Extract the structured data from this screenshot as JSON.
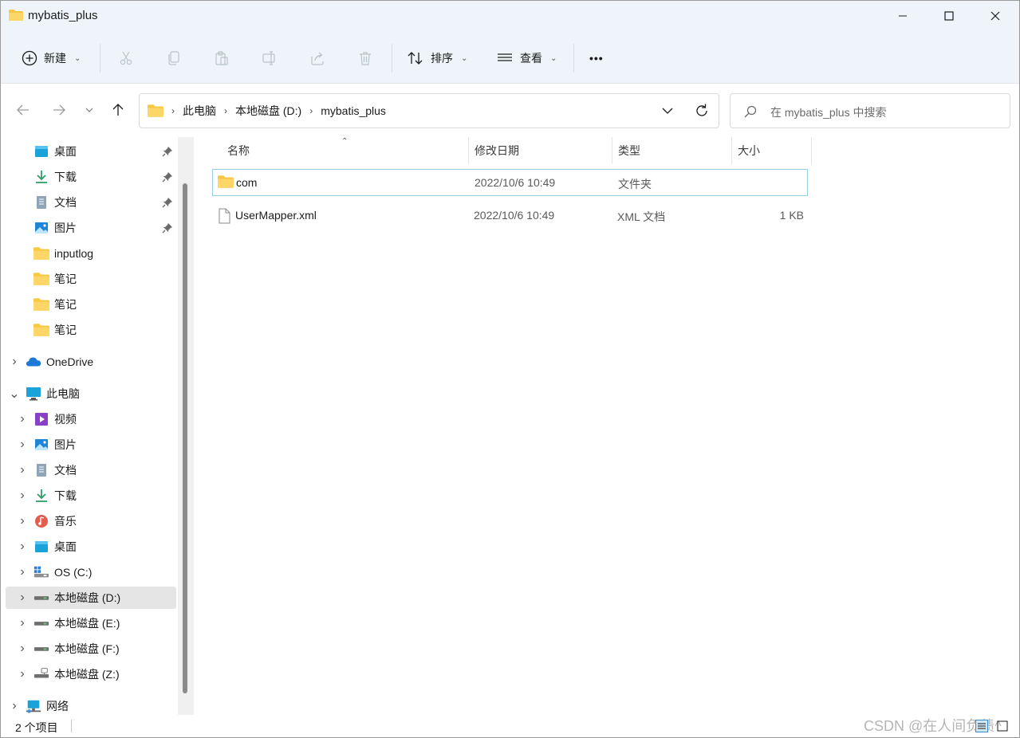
{
  "window": {
    "title": "mybatis_plus"
  },
  "toolbar": {
    "new_label": "新建",
    "sort_label": "排序",
    "view_label": "查看",
    "more_label": "•••"
  },
  "address": {
    "crumbs": [
      "此电脑",
      "本地磁盘 (D:)",
      "mybatis_plus"
    ]
  },
  "search": {
    "placeholder": "在 mybatis_plus 中搜索"
  },
  "sidebar": {
    "quick_access": [
      {
        "label": "桌面",
        "icon": "desktop-icon",
        "pinned": true
      },
      {
        "label": "下载",
        "icon": "download-icon",
        "pinned": true
      },
      {
        "label": "文档",
        "icon": "document-icon",
        "pinned": true
      },
      {
        "label": "图片",
        "icon": "picture-icon",
        "pinned": true
      },
      {
        "label": "inputlog",
        "icon": "folder-icon",
        "pinned": false
      },
      {
        "label": "笔记",
        "icon": "folder-icon",
        "pinned": false
      },
      {
        "label": "笔记",
        "icon": "folder-icon",
        "pinned": false
      },
      {
        "label": "笔记",
        "icon": "folder-icon",
        "pinned": false
      }
    ],
    "onedrive": {
      "label": "OneDrive"
    },
    "this_pc": {
      "label": "此电脑"
    },
    "pc_items": [
      {
        "label": "视频",
        "icon": "video-icon"
      },
      {
        "label": "图片",
        "icon": "picture-icon"
      },
      {
        "label": "文档",
        "icon": "document-icon"
      },
      {
        "label": "下载",
        "icon": "download-icon"
      },
      {
        "label": "音乐",
        "icon": "music-icon"
      },
      {
        "label": "桌面",
        "icon": "desktop-icon"
      },
      {
        "label": "OS (C:)",
        "icon": "os-drive-icon"
      },
      {
        "label": "本地磁盘 (D:)",
        "icon": "drive-icon",
        "selected": true
      },
      {
        "label": "本地磁盘 (E:)",
        "icon": "drive-icon"
      },
      {
        "label": "本地磁盘 (F:)",
        "icon": "drive-icon"
      },
      {
        "label": "本地磁盘 (Z:)",
        "icon": "network-drive-icon"
      }
    ],
    "network": {
      "label": "网络"
    }
  },
  "columns": {
    "name": "名称",
    "modified": "修改日期",
    "type": "类型",
    "size": "大小"
  },
  "files": [
    {
      "name": "com",
      "modified": "2022/10/6 10:49",
      "type": "文件夹",
      "size": "",
      "icon": "folder-icon",
      "selected": true
    },
    {
      "name": "UserMapper.xml",
      "modified": "2022/10/6 10:49",
      "type": "XML 文档",
      "size": "1 KB",
      "icon": "file-icon",
      "selected": false
    }
  ],
  "status": {
    "item_count": "2 个项目",
    "watermark": "CSDN @在人间负债^"
  },
  "colors": {
    "accent": "#0067c0",
    "folder": "#f8c845",
    "chrome": "#eef4f9",
    "selection_border": "#99d1e4"
  }
}
